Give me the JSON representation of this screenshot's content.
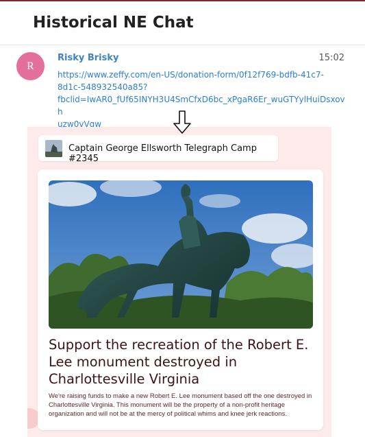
{
  "header": {
    "title": "Historical NE Chat"
  },
  "message": {
    "avatar_initial": "R",
    "sender": "Risky Brisky",
    "time": "15:02",
    "link_lines": [
      "https://www.zeffy.com/en-US/donation-form/0f12f769-bdfb-41c7-",
      "8d1c-548932540a85?",
      "fbclid=IwAR0_fUf65INYH3U4SmCfxD6bc_xPgaR6Er_wuGTYylHuiDsxovh",
      "uzw0vVgw"
    ]
  },
  "preview": {
    "org_name": "Captain George Ellsworth Telegraph Camp #2345",
    "title_lines": [
      "Support the recreation of the Robert E.",
      "Lee monument destroyed in",
      "Charlottesville Virginia"
    ],
    "description_lines": [
      "We're raising funds to make a new Robert E. Lee monument based off the one destroyed in",
      "Charlottesville Virginia. This monument will be the property of a non-profit heritage",
      "organization and will not be at the mercy of political whims and knee jerk reactions."
    ]
  },
  "colors": {
    "accent_link": "#2a7fd1",
    "sender": "#3d83c6",
    "avatar": "#e46f9a",
    "preview_bg": "#fdeaea",
    "title_text": "#3b1414"
  },
  "icons": {
    "arrow": "down-arrow-icon"
  }
}
